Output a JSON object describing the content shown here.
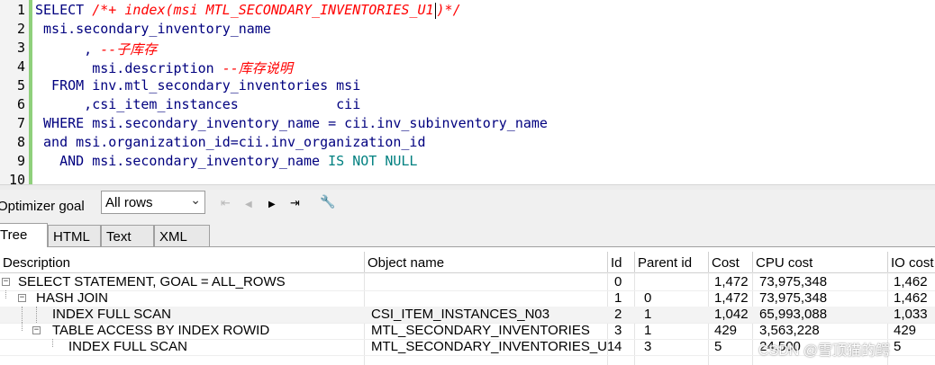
{
  "editor": {
    "line_numbers": [
      "1",
      "2",
      "3",
      "4",
      "5",
      "6",
      "7",
      "8",
      "9",
      "10"
    ],
    "lines": [
      {
        "parts": [
          {
            "t": "SELECT ",
            "c": "kw"
          },
          {
            "t": "/*+ index(msi MTL_SECONDARY_INVENTORIES_U1",
            "c": "cm"
          },
          {
            "t": "",
            "c": "cursor"
          },
          {
            "t": ")*/",
            "c": "cm"
          }
        ]
      },
      {
        "parts": [
          {
            "t": " msi.secondary_inventory_name",
            "c": "kw"
          }
        ]
      },
      {
        "parts": [
          {
            "t": "      , ",
            "c": "kw"
          },
          {
            "t": "--子库存",
            "c": "cm"
          }
        ]
      },
      {
        "parts": [
          {
            "t": "       msi.description ",
            "c": "kw"
          },
          {
            "t": "--库存说明",
            "c": "cm"
          }
        ]
      },
      {
        "parts": [
          {
            "t": "  FROM inv.mtl_secondary_inventories msi",
            "c": "kw"
          }
        ]
      },
      {
        "parts": [
          {
            "t": "      ,csi_item_instances            cii",
            "c": "kw"
          }
        ]
      },
      {
        "parts": [
          {
            "t": " WHERE msi.secondary_inventory_name = cii.inv_subinventory_name",
            "c": "kw"
          }
        ]
      },
      {
        "parts": [
          {
            "t": " and msi.organization_id=cii.inv_organization_id",
            "c": "kw"
          }
        ]
      },
      {
        "parts": [
          {
            "t": "   AND msi.secondary_inventory_name ",
            "c": "kw"
          },
          {
            "t": "IS NOT NULL",
            "c": "nl"
          }
        ]
      },
      {
        "parts": []
      }
    ]
  },
  "toolbar": {
    "goal_label": "Optimizer goal",
    "goal_value": "All rows",
    "chevron": "⌄",
    "nav_first": "⇤",
    "nav_prev": "◀",
    "nav_next": "▶",
    "nav_last": "⇥",
    "wrench": "🔧"
  },
  "tabs": [
    "Tree",
    "HTML",
    "Text",
    "XML"
  ],
  "grid": {
    "columns": [
      "Description",
      "Object name",
      "Id",
      "Parent id",
      "Cost",
      "CPU cost",
      "IO cost"
    ],
    "rows": [
      {
        "description": "SELECT STATEMENT, GOAL = ALL_ROWS",
        "object": "",
        "id": "0",
        "parent": "",
        "cost": "1,472",
        "cpu": "73,975,348",
        "io": "1,462"
      },
      {
        "description": "HASH JOIN",
        "object": "",
        "id": "1",
        "parent": "0",
        "cost": "1,472",
        "cpu": "73,975,348",
        "io": "1,462"
      },
      {
        "description": "INDEX FULL SCAN",
        "object": "CSI_ITEM_INSTANCES_N03",
        "id": "2",
        "parent": "1",
        "cost": "1,042",
        "cpu": "65,993,088",
        "io": "1,033"
      },
      {
        "description": "TABLE ACCESS BY INDEX ROWID",
        "object": "MTL_SECONDARY_INVENTORIES",
        "id": "3",
        "parent": "1",
        "cost": "429",
        "cpu": "3,563,228",
        "io": "429"
      },
      {
        "description": "INDEX FULL SCAN",
        "object": "MTL_SECONDARY_INVENTORIES_U1",
        "id": "4",
        "parent": "3",
        "cost": "5",
        "cpu": "24,500",
        "io": "5"
      }
    ]
  },
  "watermark": "CSDN @雪顶猫的鳄"
}
